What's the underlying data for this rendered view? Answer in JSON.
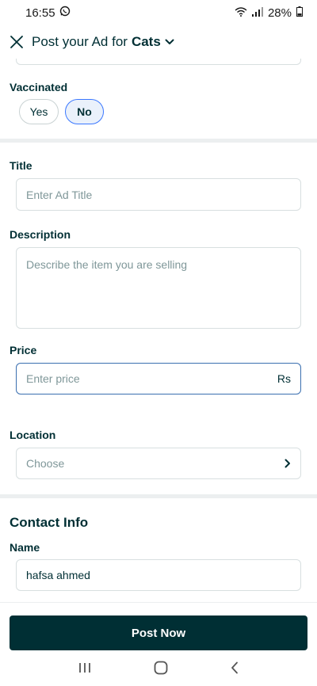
{
  "status_bar": {
    "time": "16:55",
    "battery": "28%"
  },
  "header": {
    "title_prefix": "Post your Ad for",
    "category": "Cats"
  },
  "vaccinated": {
    "label": "Vaccinated",
    "options": [
      "Yes",
      "No"
    ],
    "selected": "No"
  },
  "title_field": {
    "label": "Title",
    "placeholder": "Enter Ad Title"
  },
  "description_field": {
    "label": "Description",
    "placeholder": "Describe the item you are selling"
  },
  "price_field": {
    "label": "Price",
    "placeholder": "Enter price",
    "currency": "Rs"
  },
  "location_field": {
    "label": "Location",
    "placeholder": "Choose"
  },
  "contact": {
    "section_title": "Contact Info",
    "name_label": "Name",
    "name_value": "hafsa ahmed"
  },
  "footer": {
    "post_label": "Post Now"
  },
  "colors": {
    "primary": "#002f34",
    "selected_border": "#3a77ff",
    "selected_bg": "#eaf1fb"
  }
}
